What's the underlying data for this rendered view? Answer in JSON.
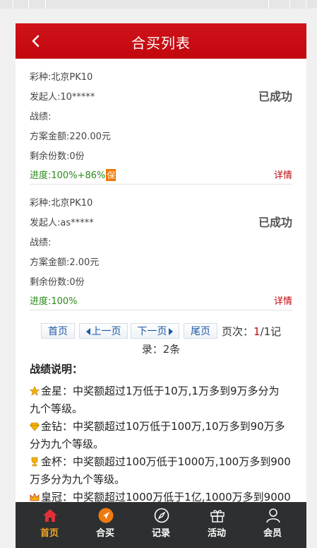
{
  "header": {
    "title": "合买列表"
  },
  "items": [
    {
      "lottery": "彩种:北京PK10",
      "initiator": "发起人:10*****",
      "status": "已成功",
      "record": "战绩:",
      "amount": "方案金额:220.00元",
      "remaining": "剩余份数:0份",
      "progress": "进度:100%+86%",
      "guarantee_badge": "保",
      "detail": "详情"
    },
    {
      "lottery": "彩种:北京PK10",
      "initiator": "发起人:as*****",
      "status": "已成功",
      "record": "战绩:",
      "amount": "方案金额:2.00元",
      "remaining": "剩余份数:0份",
      "progress": "进度:100%",
      "detail": "详情"
    }
  ],
  "pager": {
    "first": "首页",
    "prev": "上一页",
    "next": "下一页",
    "last": "尾页",
    "page_prefix": "页次：",
    "current_page": "1",
    "page_total": "/1记",
    "records": "录：2条"
  },
  "explain": {
    "heading": "战绩说明：",
    "star": {
      "icon": "star-icon",
      "line1": "金星：中奖额超过1万低于10万,1万多到9万多分为",
      "line2": "九个等级。"
    },
    "diamond": {
      "icon": "diamond-icon",
      "line1": "金钻：中奖额超过10万低于100万,10万多到90万多",
      "line2": "分为九个等级。"
    },
    "cup": {
      "icon": "cup-icon",
      "line1": "金杯：中奖额超过100万低于1000万,100万多到900",
      "line2": "万多分为九个等级。"
    },
    "crown": {
      "icon": "crown-icon",
      "line1": "皇冠：中奖额超过1000万低于1亿,1000万多到9000"
    }
  },
  "tabbar": {
    "active_color": "#f5a623",
    "items": [
      {
        "label": "首页",
        "icon": "home-icon"
      },
      {
        "label": "合买",
        "icon": "paper-plane-icon"
      },
      {
        "label": "记录",
        "icon": "compass-icon"
      },
      {
        "label": "活动",
        "icon": "gift-icon"
      },
      {
        "label": "会员",
        "icon": "user-icon"
      }
    ]
  },
  "colors": {
    "header_red": "#c1070d",
    "progress_green": "#2a8a1a",
    "badge_orange": "#f07700",
    "tabbar_bg": "#2d2f31"
  }
}
